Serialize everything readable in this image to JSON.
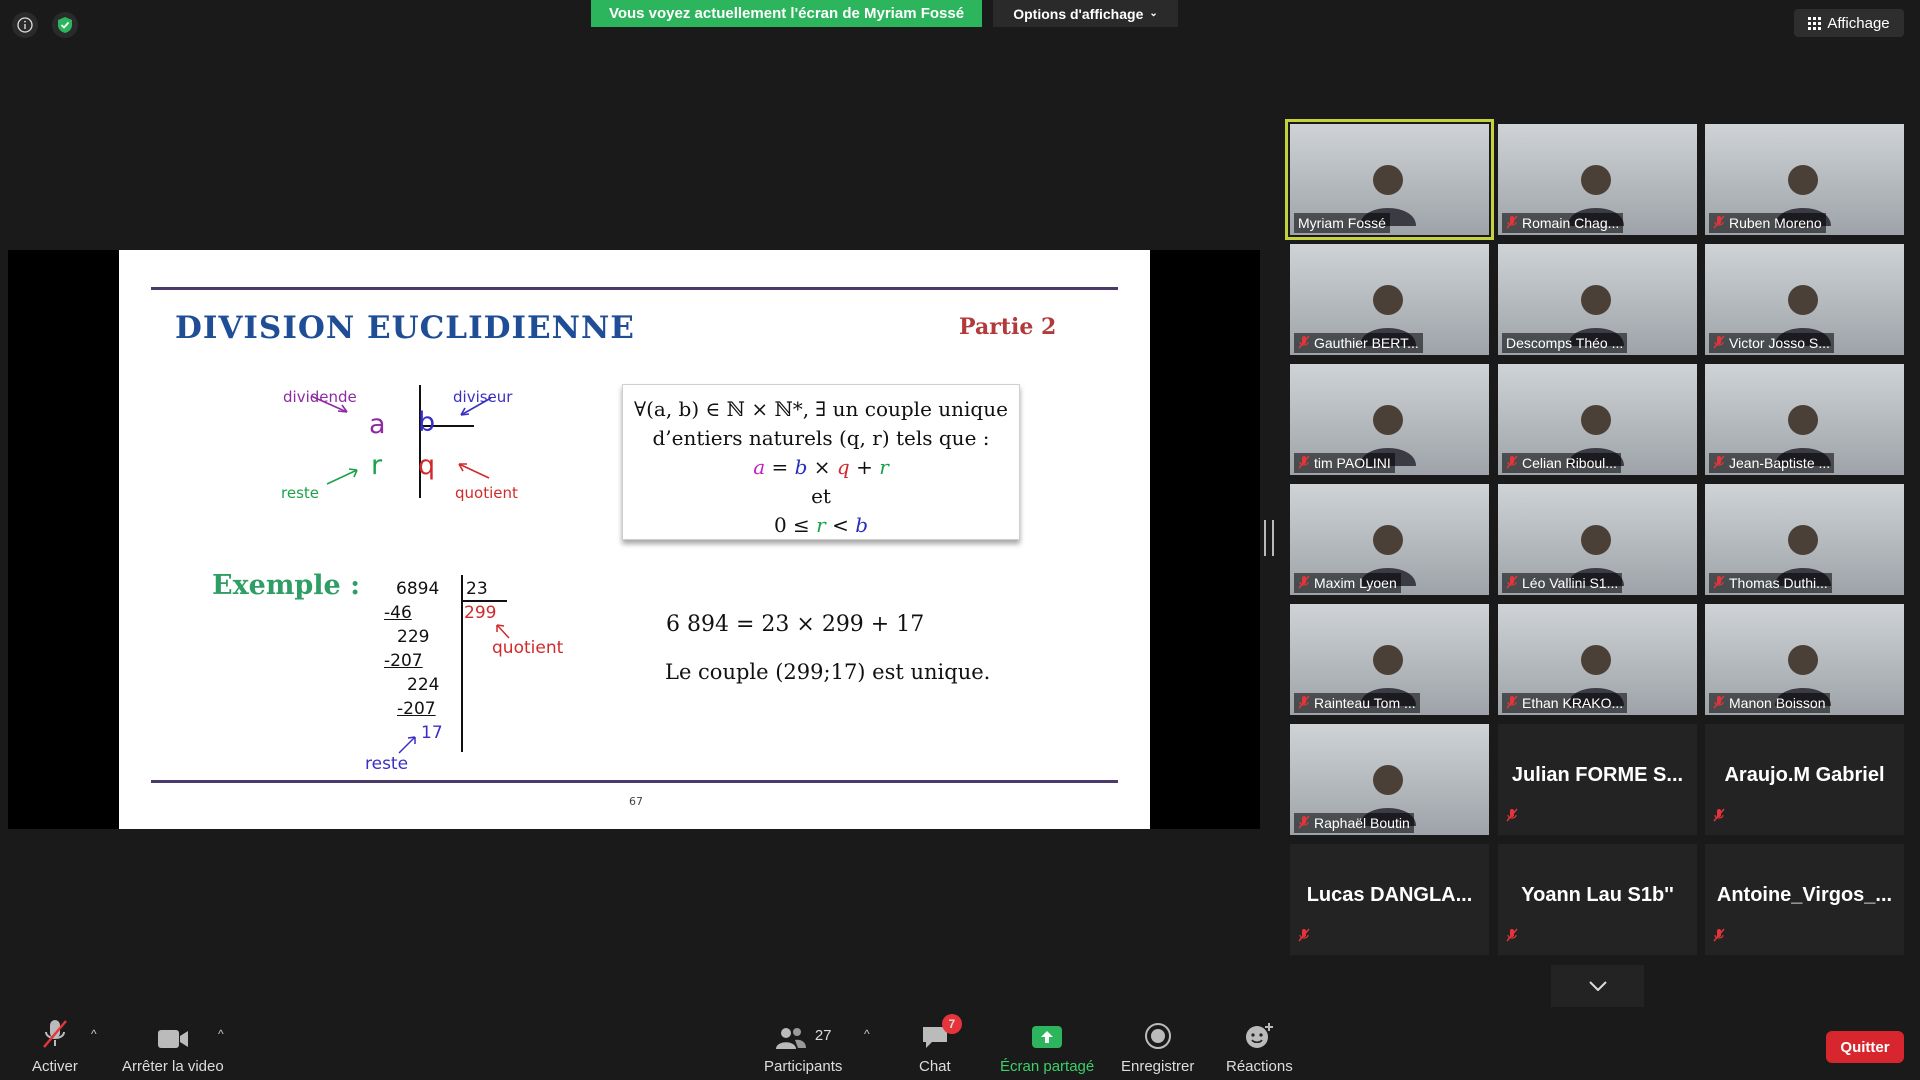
{
  "top": {
    "banner": "Vous voyez actuellement l'écran de Myriam Fossé",
    "options": "Options d'affichage",
    "affichage": "Affichage"
  },
  "slide": {
    "title": "DIVISION EUCLIDIENNE",
    "part": "Partie 2",
    "diagram": {
      "dividende": "dividende",
      "diviseur": "diviseur",
      "reste": "reste",
      "quotient": "quotient",
      "a": "a",
      "b": "b",
      "r": "r",
      "q": "q"
    },
    "theorem": {
      "line1": "∀(a, b) ∈ ℕ × ℕ*, ∃ un couple unique",
      "line2": "d’entiers naturels  (q, r) tels que :",
      "eq_a": "a",
      "eq_eq": " = ",
      "eq_b": "b",
      "eq_x": " × ",
      "eq_q": "q",
      "eq_plus": " + ",
      "eq_r": "r",
      "et": "et",
      "ineq_0": "0 ≤ ",
      "ineq_r": "r",
      "ineq_lt": " < ",
      "ineq_b": "b"
    },
    "example_label": "Exemple :",
    "division": {
      "dividend": "6894",
      "divisor": "23",
      "quotient": "299",
      "steps": [
        "-46",
        "229",
        "-207",
        "224",
        "-207",
        "17"
      ],
      "quotient_label": "quotient",
      "reste_label": "reste"
    },
    "equation": "6 894 = 23 × 299 + 17",
    "unique": "Le couple (299;17) est unique.",
    "page": "67"
  },
  "gallery": [
    {
      "name": "Myriam Fossé",
      "video": true,
      "muted": false,
      "active": true
    },
    {
      "name": "Romain Chag...",
      "video": true,
      "muted": true
    },
    {
      "name": "Ruben Moreno",
      "video": true,
      "muted": true
    },
    {
      "name": "Gauthier BERT...",
      "video": true,
      "muted": true
    },
    {
      "name": "Descomps Théo ...",
      "video": true,
      "muted": false
    },
    {
      "name": "Victor Josso S...",
      "video": true,
      "muted": true
    },
    {
      "name": "tim PAOLINI",
      "video": true,
      "muted": true
    },
    {
      "name": "Celian Riboul...",
      "video": true,
      "muted": true
    },
    {
      "name": "Jean-Baptiste ...",
      "video": true,
      "muted": true
    },
    {
      "name": "Maxim Lyoen",
      "video": true,
      "muted": true
    },
    {
      "name": "Léo Vallini S1...",
      "video": true,
      "muted": true
    },
    {
      "name": "Thomas Duthi...",
      "video": true,
      "muted": true
    },
    {
      "name": "Rainteau Tom ...",
      "video": true,
      "muted": true
    },
    {
      "name": "Ethan KRAKO...",
      "video": true,
      "muted": true
    },
    {
      "name": "Manon Boisson",
      "video": true,
      "muted": true
    },
    {
      "name": "Raphaël Boutin",
      "video": true,
      "muted": true
    },
    {
      "name": "Julian  FORME  S...",
      "video": false,
      "muted": true
    },
    {
      "name": "Araujo.M Gabriel",
      "video": false,
      "muted": true
    },
    {
      "name": "Lucas  DANGLA...",
      "video": false,
      "muted": true
    },
    {
      "name": "Yoann Lau S1b''",
      "video": false,
      "muted": true
    },
    {
      "name": "Antoine_Virgos_...",
      "video": false,
      "muted": true
    }
  ],
  "toolbar": {
    "activer": "Activer",
    "video": "Arrêter la video",
    "participants": "Participants",
    "participants_count": "27",
    "chat": "Chat",
    "chat_badge": "7",
    "share": "Écran partagé",
    "record": "Enregistrer",
    "reactions": "Réactions",
    "quit": "Quitter"
  },
  "colors": {
    "green": "#2db55d",
    "active_border": "#c4d33c",
    "quit": "#d8262e",
    "title_blue": "#1f4e96"
  }
}
